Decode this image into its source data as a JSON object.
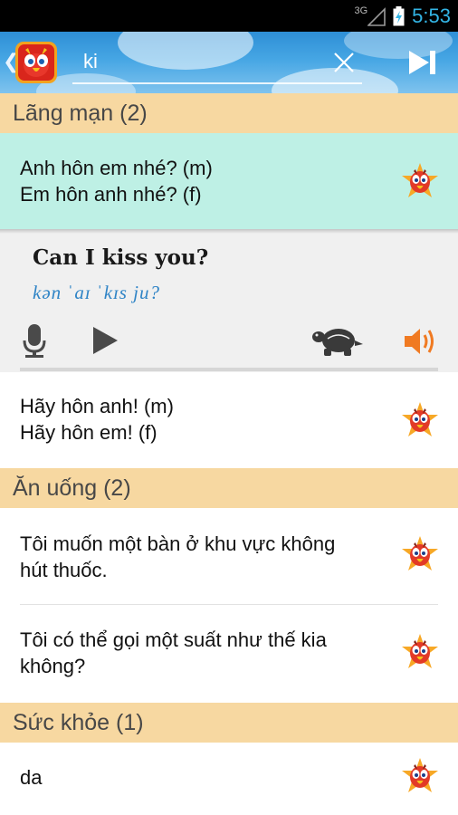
{
  "status_bar": {
    "network": "3G",
    "time": "5:53",
    "time_color": "#33b5e5"
  },
  "search": {
    "query": "ki",
    "clear_icon": "close-icon",
    "skip_icon": "skip-next-icon"
  },
  "colors": {
    "section_header_bg": "#f7d8a1",
    "selected_item_bg": "#bef0e5",
    "action_bar": "#46a6e4",
    "phonetic": "#2f84c6",
    "speaker": "#f07a22"
  },
  "sections": [
    {
      "title": "Lãng mạn (2)",
      "items": [
        {
          "line1": "Anh hôn em nhé? (m)",
          "line2": "Em hôn anh nhé? (f)"
        },
        {
          "line1": "Hãy hôn anh! (m)",
          "line2": "Hãy hôn em! (f)"
        }
      ]
    },
    {
      "title": "Ăn uống (2)",
      "items": [
        {
          "line1": "Tôi muốn một bàn ở khu vực không",
          "line2": "hút thuốc."
        },
        {
          "line1": "Tôi có thể gọi một suất như thế kia",
          "line2": "không?"
        }
      ]
    },
    {
      "title": "Sức khỏe (1)",
      "items": [
        {
          "line1": "da",
          "line2": ""
        }
      ]
    }
  ],
  "detail": {
    "translation": "Can I kiss you?",
    "phonetic": "kən ˈaɪ ˈkɪs ju?",
    "controls": [
      "microphone-icon",
      "play-icon",
      "turtle-slow-icon",
      "speaker-icon"
    ]
  }
}
